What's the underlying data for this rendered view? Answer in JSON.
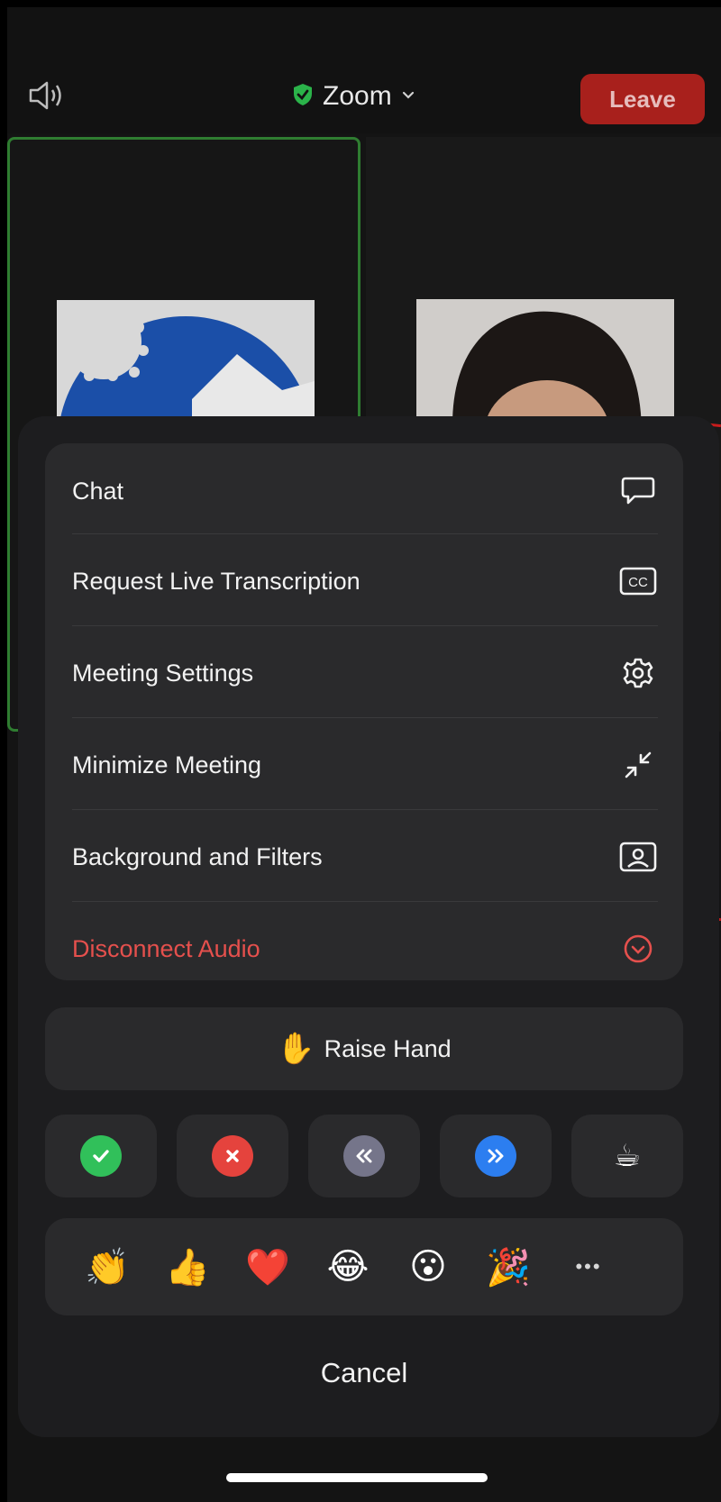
{
  "header": {
    "title": "Zoom",
    "leave_label": "Leave",
    "speaker_icon": "speaker-icon",
    "shield_color": "#2bb34a"
  },
  "menu": {
    "items": [
      {
        "label": "Chat",
        "icon": "chat-icon"
      },
      {
        "label": "Request Live Transcription",
        "icon": "cc-icon"
      },
      {
        "label": "Meeting Settings",
        "icon": "gear-icon"
      },
      {
        "label": "Minimize Meeting",
        "icon": "minimize-icon"
      },
      {
        "label": "Background and Filters",
        "icon": "background-icon"
      },
      {
        "label": "Disconnect Audio",
        "icon": "disconnect-audio-icon",
        "danger": true
      }
    ]
  },
  "raise_hand": {
    "emoji": "✋",
    "label": "Raise Hand"
  },
  "status_buttons": [
    {
      "name": "yes",
      "color": "#31c05a",
      "glyph": "✔"
    },
    {
      "name": "no",
      "color": "#e5433d",
      "glyph": "✖"
    },
    {
      "name": "slower",
      "color": "#75758a",
      "glyph": "«"
    },
    {
      "name": "faster",
      "color": "#2c7ef0",
      "glyph": "»"
    },
    {
      "name": "coffee-break",
      "glyph": "☕"
    }
  ],
  "reactions": [
    "👏",
    "👍",
    "❤️",
    "😂",
    "😮",
    "🎉",
    "•••"
  ],
  "cancel_label": "Cancel"
}
